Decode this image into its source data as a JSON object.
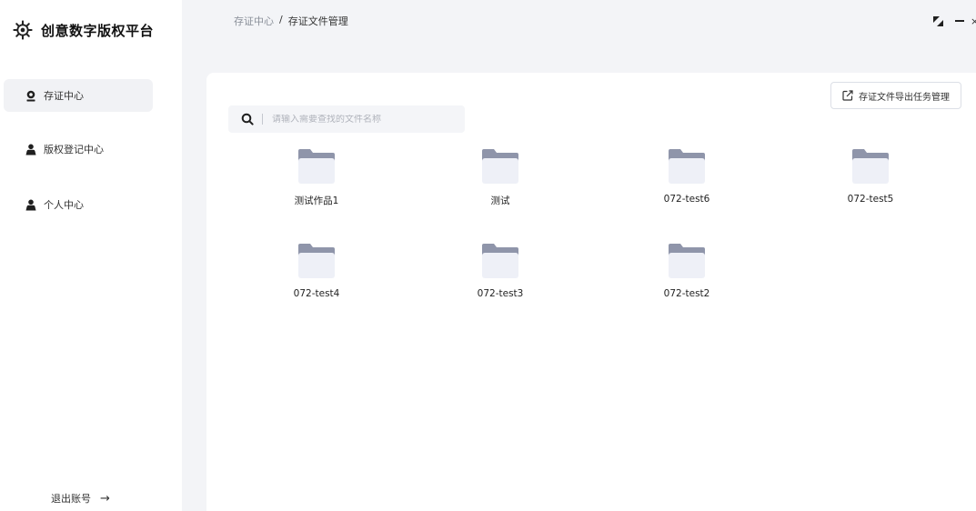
{
  "app": {
    "title": "创意数字版权平台"
  },
  "sidebar": {
    "items": [
      {
        "label": "存证中心",
        "icon": "badge-icon",
        "active": true
      },
      {
        "label": "版权登记中心",
        "icon": "user-icon",
        "active": false
      },
      {
        "label": "个人中心",
        "icon": "user-icon",
        "active": false
      }
    ],
    "logout": {
      "label": "退出账号",
      "arrow": "→"
    }
  },
  "breadcrumb": {
    "parent": "存证中心",
    "separator": "/",
    "current": "存证文件管理"
  },
  "search": {
    "placeholder": "请输入需要查找的文件名称",
    "value": ""
  },
  "toolbar": {
    "export_label": "存证文件导出任务管理"
  },
  "folders": [
    {
      "name": "测试作品1"
    },
    {
      "name": "测试"
    },
    {
      "name": "072-test6"
    },
    {
      "name": "072-test5"
    },
    {
      "name": "072-test4"
    },
    {
      "name": "072-test3"
    },
    {
      "name": "072-test2"
    }
  ],
  "colors": {
    "accent": "#222222",
    "page_bg": "#f3f4f7",
    "folder_tab": "#8f95aa",
    "folder_body": "#eef0f7"
  }
}
